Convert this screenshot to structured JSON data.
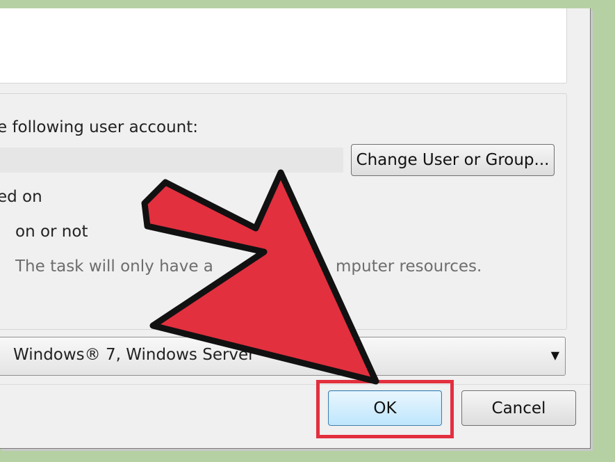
{
  "dialog": {
    "run_as_label": "e following user account:",
    "user_account_value": "",
    "change_user_button": "Change User or Group...",
    "option_logged_on": "ed on",
    "option_logged_on_or_not": "on or not",
    "hint_text": "The task will only have a",
    "hint_text_tail": "mputer resources.",
    "configure_for": "Windows® 7, Windows Server",
    "ok_button": "OK",
    "cancel_button": "Cancel"
  },
  "icons": {
    "dropdown": "chevron-down-icon",
    "pointer": "arrow-pointer-icon"
  },
  "colors": {
    "annotation_red": "#e2303f",
    "background_green": "#b5d1a4"
  }
}
